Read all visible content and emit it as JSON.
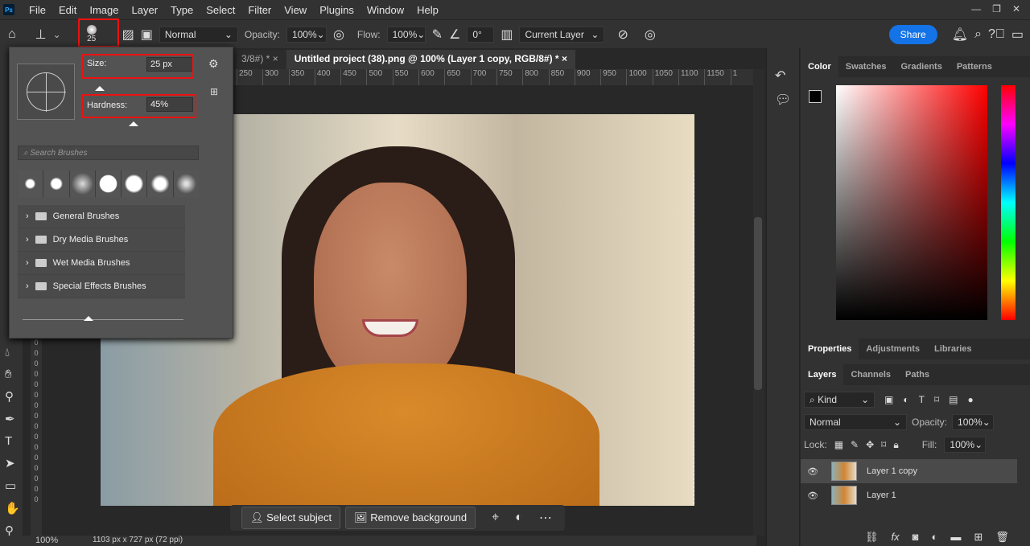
{
  "menu": [
    "File",
    "Edit",
    "Image",
    "Layer",
    "Type",
    "Select",
    "Filter",
    "View",
    "Plugins",
    "Window",
    "Help"
  ],
  "app_logo": "Ps",
  "options": {
    "brush_size": "25",
    "blend_mode": "Normal",
    "opacity_label": "Opacity:",
    "opacity": "100%",
    "flow_label": "Flow:",
    "flow": "100%",
    "angle": "0°",
    "sample": "Current Layer",
    "share": "Share"
  },
  "brush_popup": {
    "size_label": "Size:",
    "size": "25 px",
    "hardness_label": "Hardness:",
    "hardness": "45%",
    "search_placeholder": "Search Brushes",
    "folders": [
      "General Brushes",
      "Dry Media Brushes",
      "Wet Media Brushes",
      "Special Effects Brushes"
    ],
    "size_fraction": 0.25,
    "hardness_fraction": 0.45
  },
  "tabs": [
    "3/8#) *",
    "Untitled project (38).png @ 100% (Layer 1 copy, RGB/8#) *"
  ],
  "ruler": [
    "250",
    "300",
    "350",
    "400",
    "450",
    "500",
    "550",
    "600",
    "650",
    "700",
    "750",
    "800",
    "850",
    "900",
    "950",
    "1000",
    "1050",
    "1100",
    "1150",
    "1"
  ],
  "context_bar": {
    "select_subject": "Select subject",
    "remove_background": "Remove background"
  },
  "status": {
    "zoom": "100%",
    "doc_info": "1103 px x 727 px (72 ppi)"
  },
  "color_tabs": [
    "Color",
    "Swatches",
    "Gradients",
    "Patterns"
  ],
  "props_tabs": [
    "Properties",
    "Adjustments",
    "Libraries"
  ],
  "layers_tabs": [
    "Layers",
    "Channels",
    "Paths"
  ],
  "layers_panel": {
    "filter": "Kind",
    "blend": "Normal",
    "opacity_label": "Opacity:",
    "opacity": "100%",
    "lock_label": "Lock:",
    "fill_label": "Fill:",
    "fill": "100%",
    "layers": [
      "Layer 1 copy",
      "Layer 1"
    ]
  },
  "colors": {
    "accent": "#1473e6",
    "highlight": "#e11111"
  }
}
